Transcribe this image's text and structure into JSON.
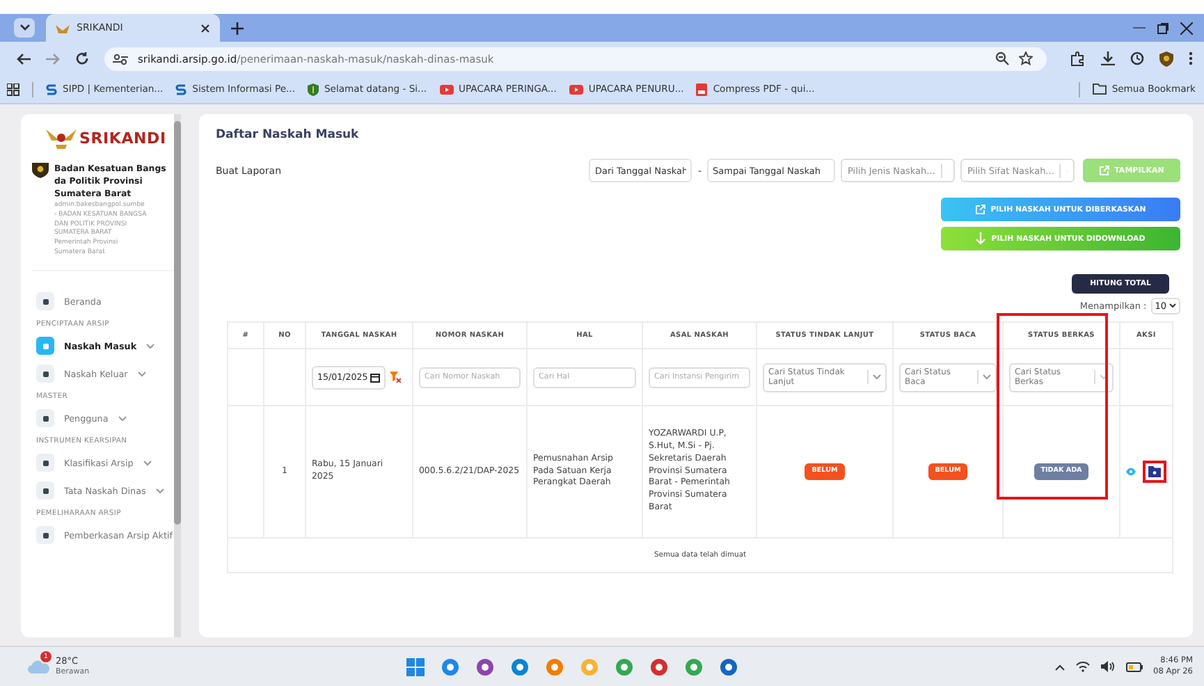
{
  "browser": {
    "tab_title": "SRIKANDI",
    "url_domain": "srikandi.arsip.go.id",
    "url_path": "/penerimaan-naskah-masuk/naskah-dinas-masuk",
    "bookmarks": [
      {
        "label": "SIPD | Kementerian...",
        "kind": "s"
      },
      {
        "label": "Sistem Informasi Pe...",
        "kind": "s"
      },
      {
        "label": "Selamat datang - Si...",
        "kind": "shield"
      },
      {
        "label": "UPACARA PERINGA...",
        "kind": "video"
      },
      {
        "label": "UPACARA PENURU...",
        "kind": "video"
      },
      {
        "label": "Compress PDF - qui...",
        "kind": "pdf"
      }
    ],
    "bookmarks_folder": "Semua Bookmark"
  },
  "sidebar": {
    "logo": "SRIKANDI",
    "org_lines": [
      "Badan Kesatuan Bangs",
      "da Politik Provinsi",
      "Sumatera Barat"
    ],
    "user_lines": [
      "admin.bakesbangpol.sumbe",
      "- BADAN KESATUAN BANGSA",
      "DAN POLITIK PROVINSI",
      "SUMATERA BARAT",
      "Pemerintah Provinsi",
      "Sumatera Barat"
    ],
    "items": [
      {
        "kind": "item",
        "label": "Beranda",
        "selected": false,
        "chevron": false
      },
      {
        "kind": "section",
        "label": "PENCIPTAAN ARSIP"
      },
      {
        "kind": "item",
        "label": "Naskah Masuk",
        "selected": true,
        "chevron": true
      },
      {
        "kind": "item",
        "label": "Naskah Keluar",
        "selected": false,
        "chevron": true
      },
      {
        "kind": "section",
        "label": "MASTER"
      },
      {
        "kind": "item",
        "label": "Pengguna",
        "selected": false,
        "chevron": true
      },
      {
        "kind": "section",
        "label": "INSTRUMEN KEARSIPAN"
      },
      {
        "kind": "item",
        "label": "Klasifikasi Arsip",
        "selected": false,
        "chevron": true
      },
      {
        "kind": "item",
        "label": "Tata Naskah Dinas",
        "selected": false,
        "chevron": true
      },
      {
        "kind": "section",
        "label": "PEMELIHARAAN ARSIP"
      },
      {
        "kind": "item",
        "label": "Pemberkasan Arsip Aktif",
        "selected": false,
        "chevron": false
      }
    ]
  },
  "main": {
    "title": "Daftar Naskah Masuk",
    "report_label": "Buat Laporan",
    "date_from_placeholder": "Dari Tanggal Naskah",
    "date_separator": "-",
    "date_to_placeholder": "Sampai Tanggal Naskah",
    "jenis_placeholder": "Pilih Jenis Naskah...",
    "sifat_placeholder": "Pilih Sifat Naskah...",
    "show_button": "TAMPILKAN",
    "action_buttons": [
      {
        "label": "PILIH NASKAH UNTUK DIBERKASKAN",
        "kind": "file"
      },
      {
        "label": "PILIH NASKAH UNTUK DIDOWNLOAD",
        "kind": "download"
      }
    ],
    "count_button": "HITUNG TOTAL",
    "page_size_label": "Menampilkan :",
    "page_size": "10"
  },
  "table": {
    "columns": [
      {
        "label": "#",
        "highlighted": false
      },
      {
        "label": "NO",
        "highlighted": false
      },
      {
        "label": "TANGGAL NASKAH",
        "highlighted": false
      },
      {
        "label": "NOMOR NASKAH",
        "highlighted": false
      },
      {
        "label": "HAL",
        "highlighted": false
      },
      {
        "label": "ASAL NASKAH",
        "highlighted": false
      },
      {
        "label": "STATUS TINDAK LANJUT",
        "highlighted": false
      },
      {
        "label": "STATUS BACA",
        "highlighted": false
      },
      {
        "label": "STATUS BERKAS",
        "highlighted": true
      },
      {
        "label": "AKSI",
        "highlighted": false
      }
    ],
    "filters": {
      "date_value": "15/01/2025",
      "nomor_placeholder": "Cari Nomor Naskah",
      "hal_placeholder": "Cari Hal",
      "asal_placeholder": "Cari Instansi Pengirim",
      "tindak_placeholder": "Cari Status Tindak Lanjut",
      "baca_placeholder": "Cari Status Baca",
      "berkas_placeholder": "Cari Status Berkas"
    },
    "rows": [
      {
        "no": "1",
        "tanggal": "Rabu, 15 Januari 2025",
        "nomor": "000.5.6.2/21/DAP-2025",
        "hal": "Pemusnahan Arsip Pada Satuan Kerja Perangkat Daerah",
        "asal": "YOZARWARDI U.P, S.Hut, M.Si - Pj. Sekretaris Daerah Provinsi Sumatera Barat - Pemerintah Provinsi Sumatera Barat",
        "status_tindak_lanjut": {
          "label": "BELUM",
          "color": "#f4511e"
        },
        "status_baca": {
          "label": "BELUM",
          "color": "#f4511e"
        },
        "status_berkas": {
          "label": "TIDAK ADA",
          "color": "#6f7fa3"
        },
        "file_action_highlighted": true
      }
    ],
    "footer": "Semua data telah dimuat"
  },
  "taskbar": {
    "temperature": "28°C",
    "weather": "Berawan",
    "weather_badge": "1",
    "time": "8:46 PM",
    "date": "08 Apr 26"
  }
}
